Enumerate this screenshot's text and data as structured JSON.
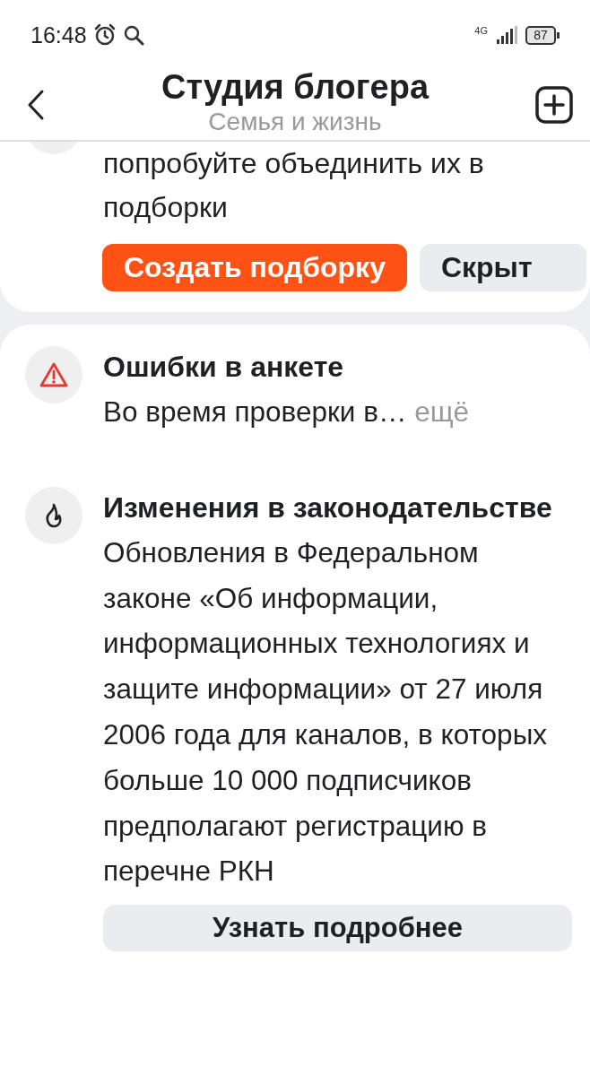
{
  "status_bar": {
    "time": "16:48",
    "network": "4G",
    "battery": "87"
  },
  "header": {
    "title": "Студия блогера",
    "subtitle": "Семья и жизнь"
  },
  "promo_card": {
    "text": "попробуйте объединить их в подборки",
    "buttons": [
      {
        "label": "Создать подборку",
        "kind": "primary"
      },
      {
        "label": "Скрыт",
        "kind": "secondary"
      }
    ]
  },
  "notices": [
    {
      "kind": "warning",
      "title": "Ошибки в анкете",
      "text": "Во время проверки в…",
      "more": "ещё"
    },
    {
      "kind": "update",
      "title": "Изменения в законодательстве",
      "text": "Обновления в Федеральном законе «Об информации, информационных технологиях и защите информации» от 27 июля 2006 года для каналов, в которых больше 10 000 подписчиков предполагают регистрацию в перечне РКН",
      "button": "Узнать подробнее"
    }
  ]
}
